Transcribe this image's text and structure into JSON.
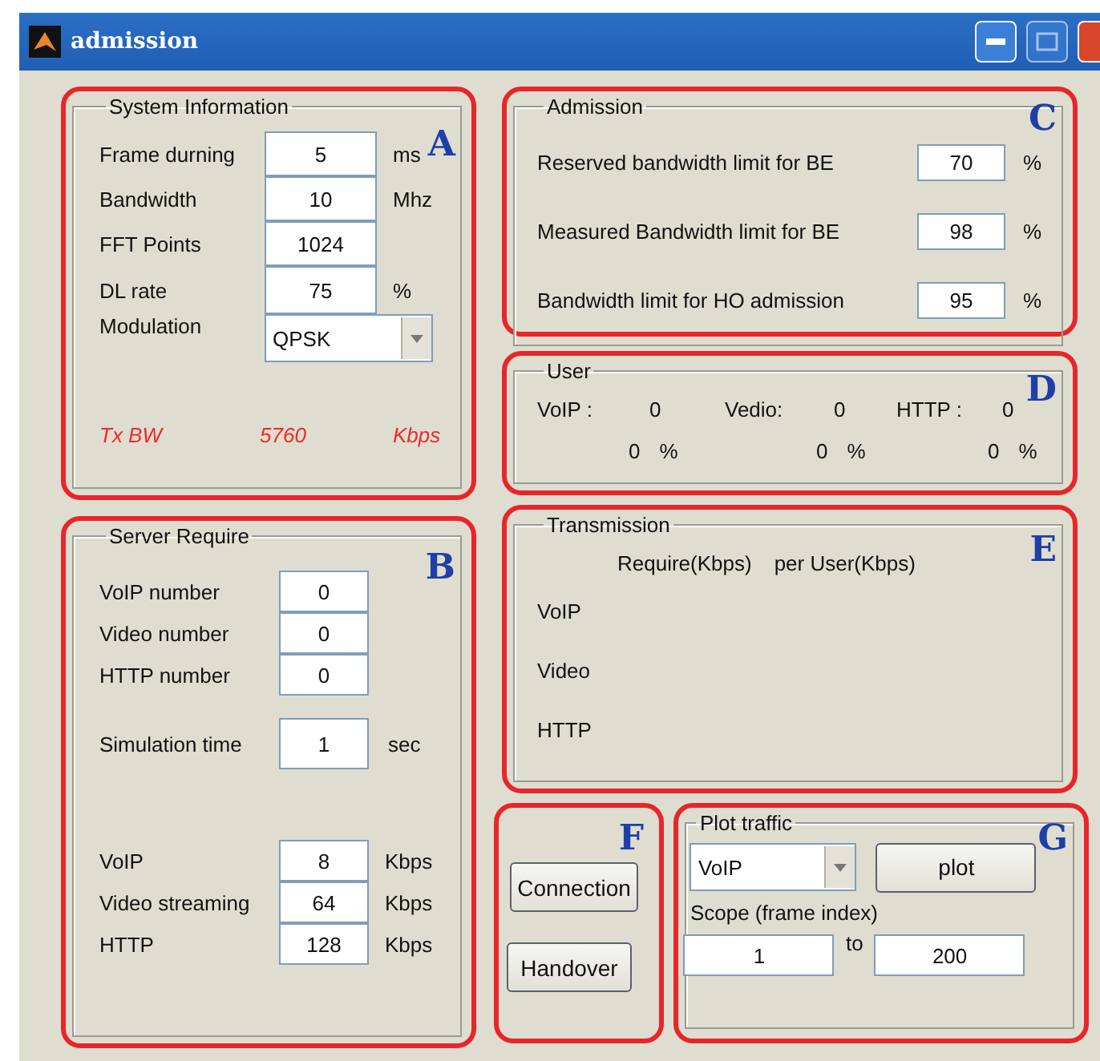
{
  "window": {
    "title": "admission"
  },
  "system_information": {
    "title": "System Information",
    "marker": "A",
    "fields": [
      {
        "label": "Frame durning",
        "value": "5",
        "unit": "ms"
      },
      {
        "label": "Bandwidth",
        "value": "10",
        "unit": "Mhz"
      },
      {
        "label": "FFT Points",
        "value": "1024"
      },
      {
        "label": "DL rate",
        "value": "75",
        "unit": "%"
      }
    ],
    "modulation": {
      "label": "Modulation",
      "value": "QPSK"
    },
    "tx_bw": {
      "label": "Tx BW",
      "value": "5760",
      "unit": "Kbps"
    }
  },
  "server_require": {
    "title": "Server Require",
    "marker": "B",
    "counts": [
      {
        "label": "VoIP number",
        "value": "0"
      },
      {
        "label": "Video number",
        "value": "0"
      },
      {
        "label": "HTTP number",
        "value": "0"
      }
    ],
    "simulation": {
      "label": "Simulation time",
      "value": "1",
      "unit": "sec"
    },
    "rates": [
      {
        "label": "VoIP",
        "value": "8",
        "unit": "Kbps"
      },
      {
        "label": "Video streaming",
        "value": "64",
        "unit": "Kbps"
      },
      {
        "label": "HTTP",
        "value": "128",
        "unit": "Kbps"
      }
    ]
  },
  "admission": {
    "title": "Admission",
    "marker": "C",
    "fields": [
      {
        "label": "Reserved bandwidth limit for BE",
        "value": "70",
        "unit": "%"
      },
      {
        "label": "Measured Bandwidth limit for BE",
        "value": "98",
        "unit": "%"
      },
      {
        "label": "Bandwidth limit for HO admission",
        "value": "95",
        "unit": "%"
      }
    ]
  },
  "user": {
    "title": "User",
    "marker": "D",
    "items": [
      {
        "label": "VoIP :",
        "count": "0",
        "percent": "0",
        "unit": "%"
      },
      {
        "label": "Vedio:",
        "count": "0",
        "percent": "0",
        "unit": "%"
      },
      {
        "label": "HTTP :",
        "count": "0",
        "percent": "0",
        "unit": "%"
      }
    ]
  },
  "transmission": {
    "title": "Transmission",
    "marker": "E",
    "headers": [
      "Require(Kbps)",
      "per User(Kbps)"
    ],
    "rows": [
      "VoIP",
      "Video",
      "HTTP"
    ]
  },
  "actions": {
    "marker": "F",
    "buttons": [
      "Connection",
      "Handover"
    ]
  },
  "plot_traffic": {
    "title": "Plot traffic",
    "marker": "G",
    "traffic": "VoIP",
    "button": "plot",
    "scope_label": "Scope (frame index)",
    "from": "1",
    "to_label": "to",
    "to": "200"
  }
}
